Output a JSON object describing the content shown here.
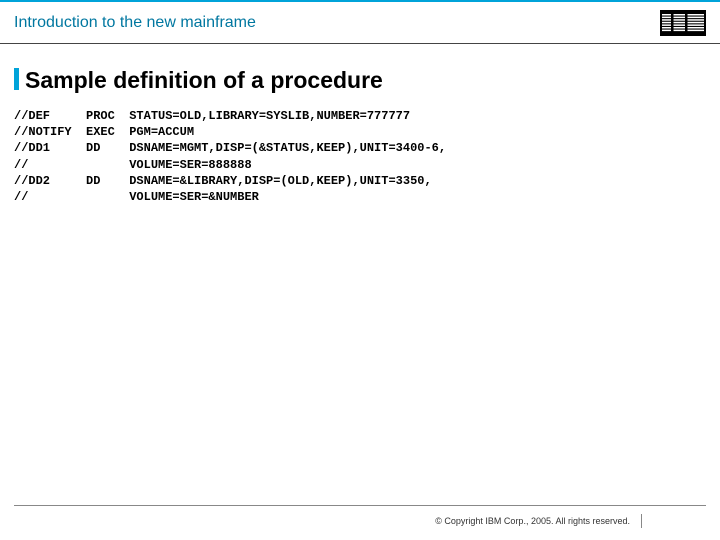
{
  "header": {
    "title": "Introduction to the new mainframe",
    "logo_name": "ibm-logo"
  },
  "slide": {
    "title": "Sample definition of a procedure"
  },
  "code": {
    "lines": [
      {
        "label": "//DEF",
        "op": "PROC",
        "params": "STATUS=OLD,LIBRARY=SYSLIB,NUMBER=777777"
      },
      {
        "label": "//NOTIFY",
        "op": "EXEC",
        "params": "PGM=ACCUM"
      },
      {
        "label": "//DD1",
        "op": "DD",
        "params": "DSNAME=MGMT,DISP=(&STATUS,KEEP),UNIT=3400-6,"
      },
      {
        "label": "//",
        "op": "",
        "params": "VOLUME=SER=888888"
      },
      {
        "label": "//DD2",
        "op": "DD",
        "params": "DSNAME=&LIBRARY,DISP=(OLD,KEEP),UNIT=3350,"
      },
      {
        "label": "//",
        "op": "",
        "params": "VOLUME=SER=&NUMBER"
      }
    ]
  },
  "footer": {
    "copyright": "© Copyright IBM Corp., 2005. All rights reserved."
  }
}
